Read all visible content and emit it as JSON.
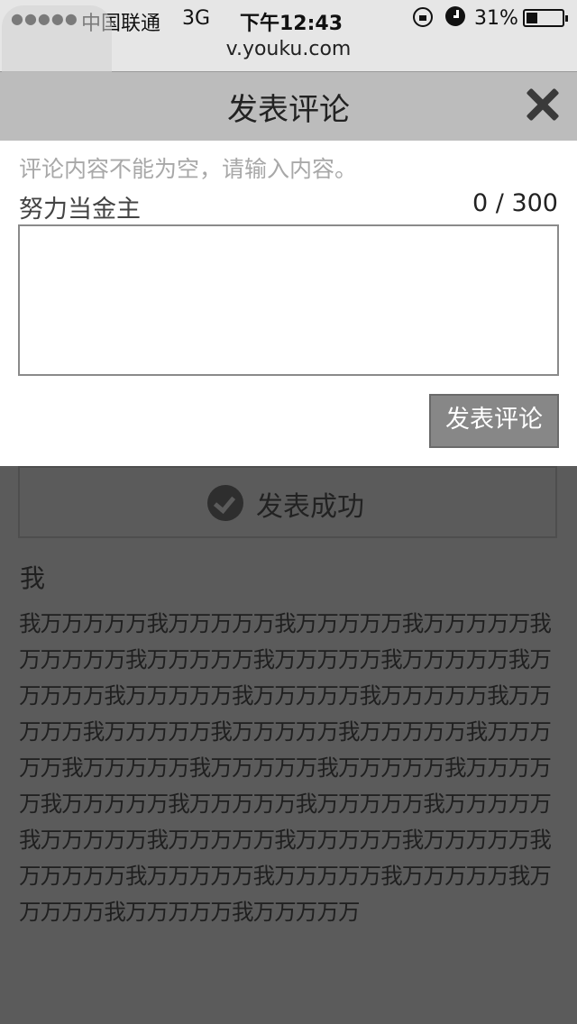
{
  "status_bar": {
    "signal": "●●●●●",
    "carrier": "中国联通",
    "network": "3G",
    "time": "下午12:43",
    "battery_percent": "31%"
  },
  "browser": {
    "url": "v.youku.com"
  },
  "dialog": {
    "title": "发表评论",
    "error_message": "评论内容不能为空，请输入内容。",
    "username": "努力当金主",
    "char_count": "0 / 300",
    "input_value": "",
    "submit_label": "发表评论"
  },
  "page": {
    "success_message": "发表成功",
    "comment_author": "我",
    "comment_text": "我万万万万万我万万万万万我万万万万万我万万万万万我万万万万万我万万万万万我万万万万万我万万万万万我万万万万万我万万万万万我万万万万万我万万万万万我万万万万万我万万万万万我万万万万万我万万万万万我万万万万万我万万万万万我万万万万万我万万万万万我万万万万万我万万万万万我万万万万万我万万万万万我万万万万万我万万万万万我万万万万万我万万万万万我万万万万万我万万万万万我万万万万万我万万万万万我万万万万万我万万万万万我万万万万万我万万万万万"
  }
}
